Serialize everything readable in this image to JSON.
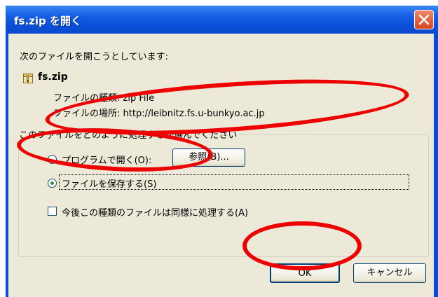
{
  "window": {
    "title": "fs.zip を開く"
  },
  "dialog": {
    "prompt": "次のファイルを開こうとしています:",
    "file_name": "fs.zip",
    "file_type": "ファイルの種類: zip File",
    "file_location": "ファイルの場所: http://leibnitz.fs.u-bunkyo.ac.jp",
    "group_caption": "このファイルをどのように処理するか選んでください",
    "option_open": "プログラムで開く(O):",
    "browse_button": "参照(B)...",
    "option_save": "ファイルを保存する(S)",
    "remember_checkbox": "今後この種類のファイルは同様に処理する(A)",
    "ok_button": "OK",
    "cancel_button": "キャンセル"
  },
  "state": {
    "selected_option": "save",
    "remember_checked": false
  },
  "colors": {
    "title_bar": "#0b4fd8",
    "dialog_bg": "#ece9d8",
    "annotation": "#ee0000"
  }
}
